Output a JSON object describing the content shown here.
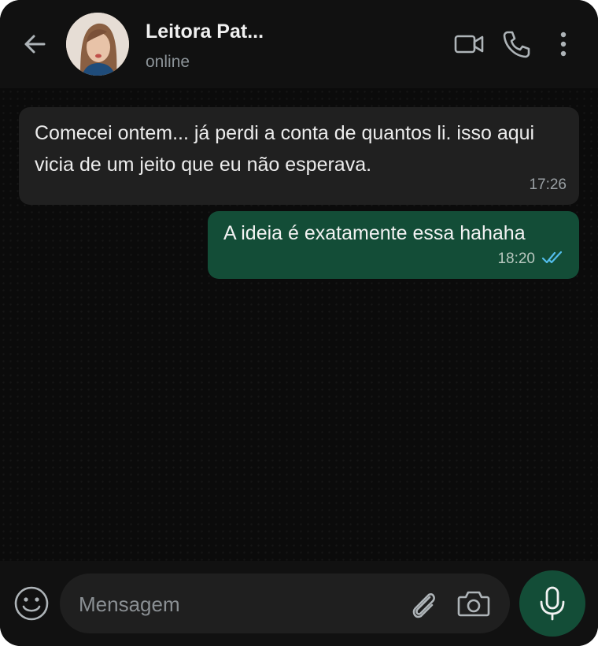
{
  "header": {
    "back_icon": "arrow-left-icon",
    "contact_name": "Leitora Pat...",
    "status": "online",
    "icons": [
      "video-call-icon",
      "phone-icon",
      "more-vertical-icon"
    ]
  },
  "messages": [
    {
      "direction": "incoming",
      "text": "Comecei ontem... já perdi a conta de quantos li. isso aqui vicia de um jeito que eu não esperava.",
      "time": "17:26"
    },
    {
      "direction": "outgoing",
      "text": "A ideia é exatamente essa hahaha",
      "time": "18:20",
      "status_icon": "double-check-icon"
    }
  ],
  "composer": {
    "emoji_icon": "emoji-icon",
    "placeholder": "Mensagem",
    "attach_icon": "paperclip-icon",
    "camera_icon": "camera-icon",
    "mic_icon": "microphone-icon"
  },
  "colors": {
    "background": "#0b0b0b",
    "header": "#111111",
    "incoming_bubble": "#202020",
    "outgoing_bubble": "#134d37",
    "read_ticks": "#53bdeb"
  }
}
